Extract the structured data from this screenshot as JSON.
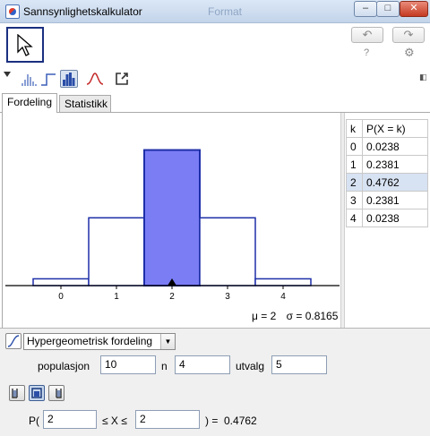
{
  "window": {
    "title": "Sannsynlighetskalkulator",
    "ghost_title": "Format",
    "controls": {
      "minimize": "–",
      "maximize": "□",
      "close": "✕"
    }
  },
  "toolbar": {
    "move_tool": "move-arrow-icon",
    "undo": "↶",
    "redo": "↷",
    "help": "?",
    "settings": "⚙"
  },
  "tabs": [
    {
      "label": "Fordeling",
      "active": true
    },
    {
      "label": "Statistikk",
      "active": false
    }
  ],
  "chart_data": {
    "type": "bar",
    "categories": [
      "0",
      "1",
      "2",
      "3",
      "4"
    ],
    "values": [
      0.0238,
      0.2381,
      0.4762,
      0.2381,
      0.0238
    ],
    "highlight": [
      "2"
    ],
    "ylim": [
      0,
      0.5
    ],
    "marker_at": "2",
    "colors": {
      "bar_stroke": "#1e2fa8",
      "highlight_fill": "#7b7df5",
      "bar_fill": "#ffffff"
    },
    "stats": {
      "mu": "μ = 2",
      "sigma": "σ = 0.8165"
    }
  },
  "table": {
    "headers": [
      "k",
      "P(X = k)"
    ],
    "rows": [
      {
        "k": "0",
        "p": "0.0238"
      },
      {
        "k": "1",
        "p": "0.2381"
      },
      {
        "k": "2",
        "p": "0.4762",
        "selected": true
      },
      {
        "k": "3",
        "p": "0.2381"
      },
      {
        "k": "4",
        "p": "0.0238"
      }
    ]
  },
  "controls": {
    "distribution": "Hypergeometrisk fordeling",
    "populasjon_label": "populasjon",
    "populasjon_value": "10",
    "n_label": "n",
    "n_value": "4",
    "utvalg_label": "utvalg",
    "utvalg_value": "5",
    "prob_prefix": "P(",
    "lower": "2",
    "middle": "≤ X ≤",
    "upper": "2",
    "result": ") =  0.4762"
  }
}
